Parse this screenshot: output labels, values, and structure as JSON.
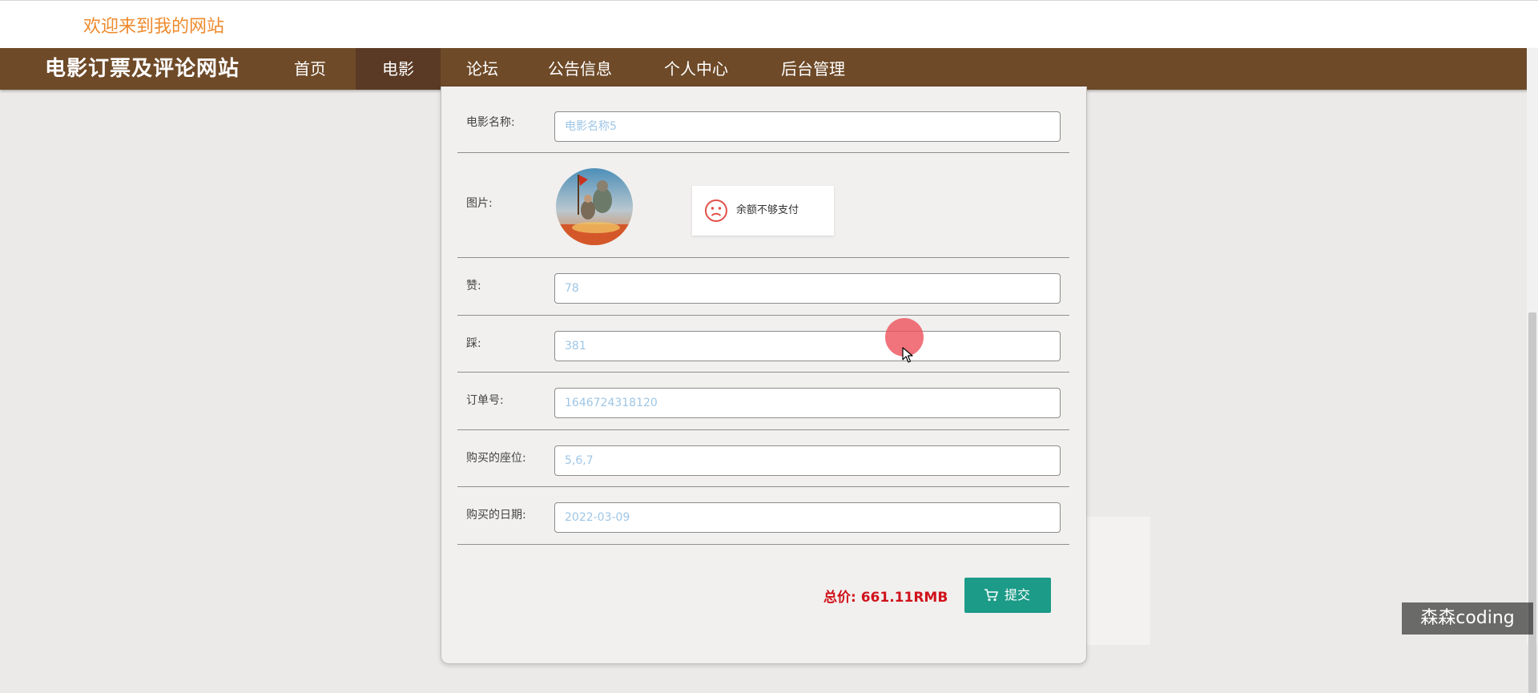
{
  "header": {
    "welcome": "欢迎来到我的网站"
  },
  "navbar": {
    "brand": "电影订票及评论网站",
    "items": [
      {
        "label": "首页",
        "active": false
      },
      {
        "label": "电影",
        "active": true
      },
      {
        "label": "论坛",
        "active": false
      },
      {
        "label": "公告信息",
        "active": false
      },
      {
        "label": "个人中心",
        "active": false
      },
      {
        "label": "后台管理",
        "active": false
      }
    ]
  },
  "form": {
    "movie_name": {
      "label": "电影名称:",
      "value": "电影名称5"
    },
    "picture": {
      "label": "图片:"
    },
    "likes": {
      "label": "赞:",
      "value": "78"
    },
    "dislikes": {
      "label": "踩:",
      "value": "381"
    },
    "order_no": {
      "label": "订单号:",
      "value": "1646724318120"
    },
    "seats": {
      "label": "购买的座位:",
      "value": "5,6,7"
    },
    "date": {
      "label": "购买的日期:",
      "value": "2022-03-09"
    }
  },
  "toast": {
    "icon": "sad-face-icon",
    "message": "余额不够支付",
    "color": "#e2504a"
  },
  "summary": {
    "total": "总价: 661.11RMB",
    "submit_label": "提交",
    "submit_icon": "cart-icon"
  },
  "watermark": "森森coding",
  "colors": {
    "nav_bg": "#6e4a28",
    "nav_active": "#5a3a24",
    "welcome": "#ee8a2c",
    "submit_bg": "#1c9b88",
    "total": "#d0121a",
    "input_text": "#9ec6e6"
  }
}
